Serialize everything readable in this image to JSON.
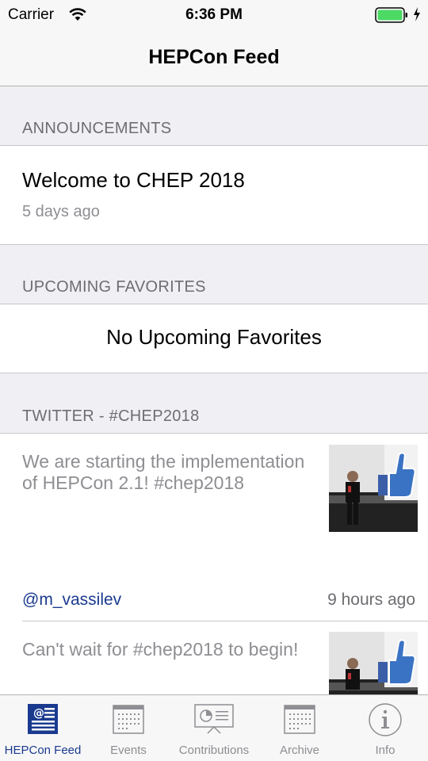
{
  "status_bar": {
    "carrier": "Carrier",
    "time": "6:36 PM"
  },
  "nav": {
    "title": "HEPCon Feed"
  },
  "sections": {
    "announcements": {
      "header": "ANNOUNCEMENTS",
      "items": [
        {
          "title": "Welcome to CHEP 2018",
          "time": "5 days ago"
        }
      ]
    },
    "favorites": {
      "header": "UPCOMING FAVORITES",
      "empty_text": "No Upcoming Favorites"
    },
    "twitter": {
      "header": "TWITTER - #CHEP2018",
      "tweets": [
        {
          "text": "We are starting the implementation of HEPCon 2.1! #chep2018",
          "user": "@m_vassilev",
          "time": "9 hours ago"
        },
        {
          "text": "Can't wait for #chep2018 to begin!"
        }
      ]
    }
  },
  "tabs": [
    {
      "label": "HEPCon Feed",
      "icon": "feed-icon",
      "active": true
    },
    {
      "label": "Events",
      "icon": "calendar-icon"
    },
    {
      "label": "Contributions",
      "icon": "presentation-icon"
    },
    {
      "label": "Archive",
      "icon": "archive-icon"
    },
    {
      "label": "Info",
      "icon": "info-icon"
    }
  ],
  "colors": {
    "accent": "#1a3a8f",
    "battery": "#4cd964",
    "secondary_text": "#8e8e93"
  }
}
